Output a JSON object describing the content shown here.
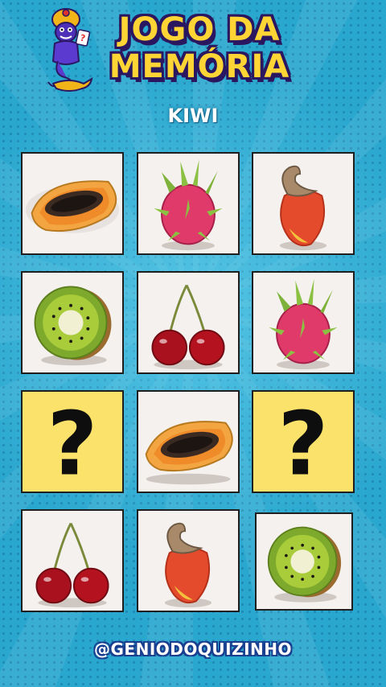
{
  "header": {
    "title_line1": "JOGO DA",
    "title_line2": "MEMÓRIA"
  },
  "target_word": "KIWI",
  "board": {
    "cards": [
      {
        "state": "revealed",
        "fruit": "papaya"
      },
      {
        "state": "revealed",
        "fruit": "dragon-fruit"
      },
      {
        "state": "revealed",
        "fruit": "cashew-fruit"
      },
      {
        "state": "revealed",
        "fruit": "kiwi"
      },
      {
        "state": "revealed",
        "fruit": "cherries"
      },
      {
        "state": "revealed",
        "fruit": "dragon-fruit"
      },
      {
        "state": "hidden",
        "symbol": "?"
      },
      {
        "state": "revealed",
        "fruit": "papaya"
      },
      {
        "state": "hidden",
        "symbol": "?"
      },
      {
        "state": "revealed",
        "fruit": "cherries"
      },
      {
        "state": "revealed",
        "fruit": "cashew-fruit"
      },
      {
        "state": "revealed",
        "fruit": "kiwi"
      }
    ]
  },
  "footer": {
    "handle": "@GENIODOQUIZINHO"
  },
  "colors": {
    "background": "#2aa7cf",
    "title_fill": "#ffd535",
    "title_outline": "#2a1760",
    "hidden_card": "#fbe36b"
  }
}
